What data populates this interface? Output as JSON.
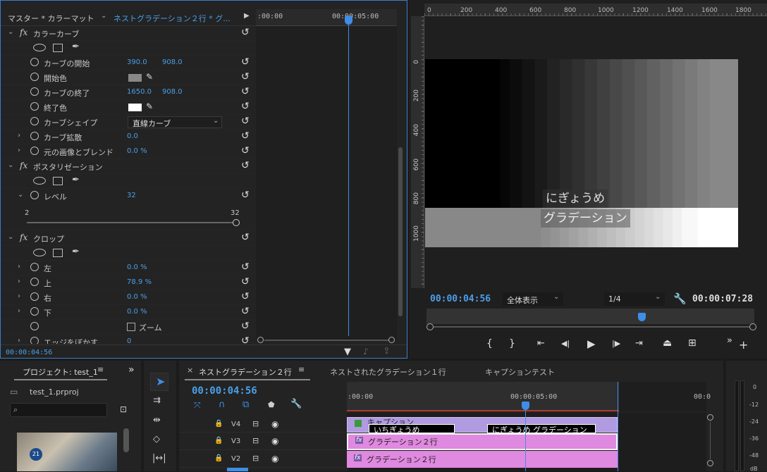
{
  "effect_controls": {
    "source_label": "マスター * カラーマット",
    "clip_label": "ネストグラデーション２行 * グ...",
    "mini_timeline": {
      "start_tc": ":00:00",
      "end_tc": "00:00:05:00"
    },
    "current_tc": "00:00:04:56",
    "color_curve": {
      "title": "カラーカーブ",
      "curve_start_label": "カーブの開始",
      "curve_start_x": "390.0",
      "curve_start_y": "908.0",
      "start_color_label": "開始色",
      "start_color": "#888888",
      "curve_end_label": "カーブの終了",
      "curve_end_x": "1650.0",
      "curve_end_y": "908.0",
      "end_color_label": "終了色",
      "end_color": "#ffffff",
      "curve_shape_label": "カーブシェイプ",
      "curve_shape_value": "直線カーブ",
      "curve_spread_label": "カーブ拡散",
      "curve_spread_value": "0.0",
      "blend_label": "元の画像とブレンド",
      "blend_value": "0.0 %"
    },
    "posterize": {
      "title": "ポスタリゼーション",
      "level_label": "レベル",
      "level_value": "32",
      "slider_min": "2",
      "slider_max": "32"
    },
    "crop": {
      "title": "クロップ",
      "left_label": "左",
      "left_value": "0.0 %",
      "top_label": "上",
      "top_value": "78.9 %",
      "right_label": "右",
      "right_value": "0.0 %",
      "bottom_label": "下",
      "bottom_value": "0.0 %",
      "zoom_label": "ズーム",
      "feather_label": "エッジをぼかす",
      "feather_value": "0"
    }
  },
  "program_monitor": {
    "ruler_labels": [
      "0",
      "200",
      "400",
      "600",
      "800",
      "1000",
      "1200",
      "1400",
      "1600",
      "1800"
    ],
    "vruler_labels": [
      "0",
      "200",
      "400",
      "600",
      "800",
      "1000"
    ],
    "caption_line1": "にぎょうめ",
    "caption_line2": "グラデーション",
    "current_tc": "00:00:04:56",
    "fit_label": "全体表示",
    "resolution_label": "1/4",
    "duration_tc": "00:00:07:28"
  },
  "project": {
    "title": "プロジェクト: test_1",
    "file": "test_1.prproj",
    "thumb_badge": "21"
  },
  "timeline": {
    "active_tab": "ネストグラデーション２行",
    "tabs": [
      "ネストされたグラデーション１行",
      "キャプションテスト"
    ],
    "current_tc": "00:00:04:56",
    "ruler_start": ":00:00",
    "ruler_mid": "00:00:05:00",
    "ruler_end": "00:0",
    "tracks": [
      {
        "name": "V4"
      },
      {
        "name": "V3"
      },
      {
        "name": "V2"
      }
    ],
    "clips": {
      "caption_track": "キャプション",
      "caption_1": "いちぎょうめ",
      "caption_2": "にぎょうめ グラデーション",
      "v3_clip": "グラデーション２行",
      "v2_clip": "グラデーション２行"
    }
  },
  "meter": {
    "labels": [
      "0",
      "-12",
      "-24",
      "-36",
      "-48",
      "dB"
    ]
  },
  "colors": {
    "accent": "#4a9fe8",
    "playhead": "#2f7fe0",
    "caption_clip": "#b09ae0",
    "fx_clip": "#e089e0"
  }
}
